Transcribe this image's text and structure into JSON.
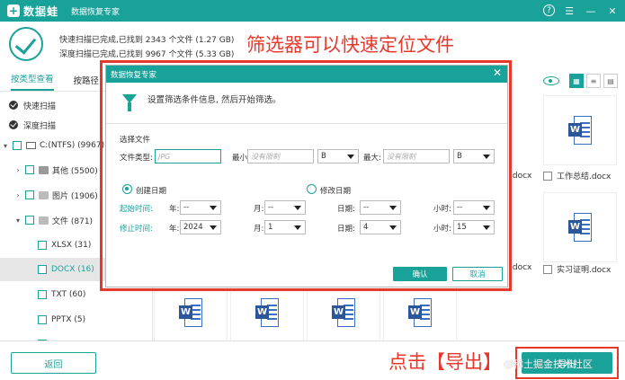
{
  "titlebar": {
    "logo_glyph": "+",
    "brand": "数据蛙",
    "subtitle": "数据恢复专家"
  },
  "status": {
    "quick_scan": "快速扫描已完成,已找到 2343 个文件 (1.27 GB)",
    "deep_scan": "深度扫描已完成,已找到 9967 个文件 (5.33 GB)"
  },
  "annotations": {
    "top": "筛选器可以快速定位文件",
    "bottom": "点击【导出】"
  },
  "sidebar": {
    "tab_type": "按类型查看",
    "tab_path": "按路径",
    "quick_scan": "快速扫描",
    "deep_scan": "深度扫描",
    "drive": "C:(NTFS) (9967)",
    "other": "其他 (5500)",
    "images": "图片 (1906)",
    "docs": "文件 (871)",
    "xlsx": "XLSX (31)",
    "docx": "DOCX (16)",
    "txt": "TXT (60)",
    "pptx": "PPTX (5)"
  },
  "files": {
    "row1_left_label": ".docx",
    "row1_right_label": "工作总结.docx",
    "row2_left_label": ".docx",
    "row2_right_label": "实习证明.docx",
    "word_glyph": "W"
  },
  "dialog": {
    "title": "数据恢复专家",
    "intro": "设置筛选条件信息, 然后开始筛选。",
    "section": "选择文件",
    "file_type_label": "文件类型:",
    "file_type_placeholder": "JPG",
    "min_label": "最小:",
    "min_placeholder": "没有限制",
    "min_unit": "B",
    "max_label": "最大:",
    "max_placeholder": "没有限制",
    "max_unit": "B",
    "created_label": "创建日期",
    "modified_label": "修改日期",
    "start_label": "起始时间:",
    "end_label": "修止时间:",
    "year_label": "年:",
    "month_label": "月:",
    "day_label": "日期:",
    "hour_label": "小时:",
    "start_year": "--",
    "start_month": "--",
    "start_day": "--",
    "start_hour": "--",
    "end_year": "2024",
    "end_month": "1",
    "end_day": "4",
    "end_hour": "15",
    "ok": "确认",
    "cancel": "取消"
  },
  "bottom": {
    "back": "返回",
    "export": "导出",
    "watermark": "@稀土掘金技术社区"
  },
  "colors": {
    "accent": "#19a29a",
    "annotation": "#e8382c",
    "word_blue": "#2b579a"
  }
}
